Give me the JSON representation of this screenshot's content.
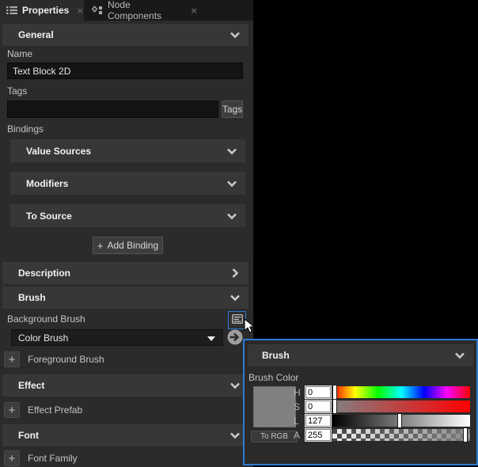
{
  "tabs": {
    "properties": {
      "label": "Properties",
      "close": "×"
    },
    "node_components": {
      "label": "Node Components",
      "close": "×"
    }
  },
  "panel": {
    "general_header": "General",
    "name_label": "Name",
    "name_value": "Text Block 2D",
    "tags_label": "Tags",
    "tags_value": "",
    "tags_button": "Tags",
    "bindings_label": "Bindings",
    "value_sources_header": "Value Sources",
    "modifiers_header": "Modifiers",
    "to_source_header": "To Source",
    "add_binding_plus": "+",
    "add_binding_label": "Add Binding",
    "description_header": "Description",
    "brush_header": "Brush",
    "background_brush_label": "Background Brush",
    "brush_type_value": "Color Brush",
    "foreground_brush_plus": "+",
    "foreground_brush_label": "Foreground Brush",
    "effect_header": "Effect",
    "effect_prefab_plus": "+",
    "effect_prefab_label": "Effect Prefab",
    "font_header": "Font",
    "font_family_plus": "+",
    "font_family_label": "Font Family"
  },
  "popup": {
    "header": "Brush",
    "color_label": "Brush Color",
    "to_rgb_button": "To RGB",
    "channels": [
      {
        "label": "H",
        "value": "0"
      },
      {
        "label": "S",
        "value": "0"
      },
      {
        "label": "L",
        "value": "127"
      },
      {
        "label": "A",
        "value": "255"
      }
    ]
  },
  "colors": {
    "accent": "#2b7cd3",
    "swatch": "#808080",
    "panel_bg": "#2b2b2b",
    "header_bg": "#373737"
  }
}
